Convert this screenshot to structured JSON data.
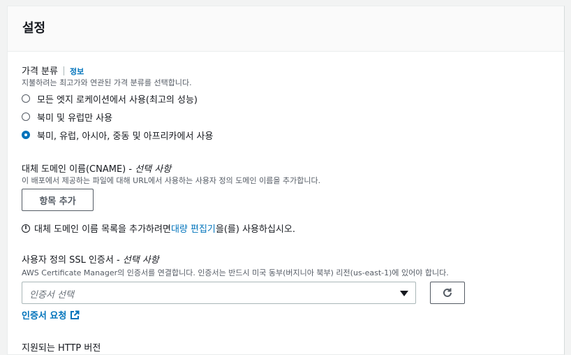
{
  "panel": {
    "title": "설정"
  },
  "price_class": {
    "label": "가격 분류",
    "info_link": "정보",
    "description": "지불하려는 최고가와 연관된 가격 분류를 선택합니다.",
    "options": [
      {
        "label": "모든 엣지 로케이션에서 사용(최고의 성능)",
        "selected": false
      },
      {
        "label": "북미 및 유럽만 사용",
        "selected": false
      },
      {
        "label": "북미, 유럽, 아시아, 중동 및 아프리카에서 사용",
        "selected": true
      }
    ]
  },
  "cname": {
    "label": "대체 도메인 이름(CNAME) - ",
    "optional": "선택 사항",
    "description": "이 배포에서 제공하는 파일에 대해 URL에서 사용하는 사용자 정의 도메인 이름을 추가합니다.",
    "add_button": "항목 추가",
    "note_prefix": "대체 도메인 이름 목록을 추가하려면 ",
    "note_link": "대량 편집기",
    "note_suffix": "을(를) 사용하십시오."
  },
  "ssl": {
    "label": "사용자 정의 SSL 인증서 - ",
    "optional": "선택 사항",
    "description": "AWS Certificate Manager의 인증서를 연결합니다. 인증서는 반드시 미국 동부(버지니아 북부) 리전(us-east-1)에 있어야 합니다.",
    "select_placeholder": "인증서 선택",
    "request_link": "인증서 요청"
  },
  "http_versions": {
    "label": "지원되는 HTTP 버전"
  },
  "icons": {
    "info": "info-circle-icon",
    "refresh": "refresh-icon",
    "external": "external-link-icon",
    "caret": "caret-down-icon"
  },
  "colors": {
    "accent": "#0073bb",
    "text": "#16191f",
    "muted": "#545b64"
  }
}
